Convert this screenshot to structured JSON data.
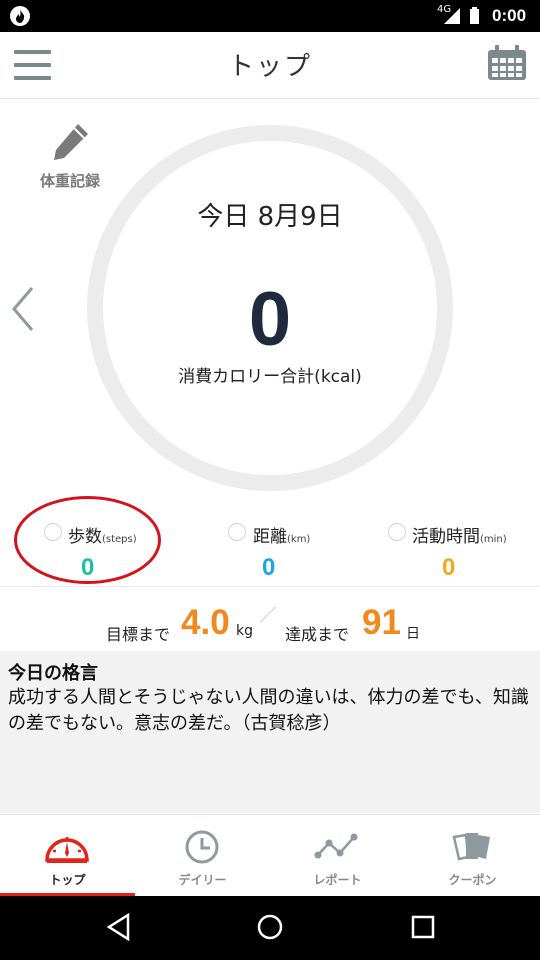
{
  "status_bar": {
    "network": "4G",
    "time": "0:00"
  },
  "header": {
    "title": "トップ"
  },
  "weight_record": {
    "label": "体重記録"
  },
  "summary": {
    "date": "今日 8月9日",
    "calories": "0",
    "calories_label": "消費カロリー合計(kcal)"
  },
  "stats": [
    {
      "label": "歩数",
      "unit": "(steps)",
      "value": "0",
      "color": "#1ec0a4"
    },
    {
      "label": "距離",
      "unit": "(km)",
      "value": "0",
      "color": "#1ea6e8"
    },
    {
      "label": "活動時間",
      "unit": "(min)",
      "value": "0",
      "color": "#f0a81c"
    }
  ],
  "goal": {
    "prefix": "目標まで",
    "weight": "4.0",
    "weight_unit": "kg",
    "days_prefix": "達成まで",
    "days": "91",
    "days_unit": "日"
  },
  "quote": {
    "title": "今日の格言",
    "body": "成功する人間とそうじゃない人間の違いは、体力の差でも、知識の差でもない。意志の差だ。（古賀稔彦）"
  },
  "bottom_nav": [
    {
      "label": "トップ",
      "icon": "speedometer-icon",
      "active": true
    },
    {
      "label": "デイリー",
      "icon": "clock-icon",
      "active": false
    },
    {
      "label": "レポート",
      "icon": "line-chart-icon",
      "active": false
    },
    {
      "label": "クーポン",
      "icon": "coupon-cards-icon",
      "active": false
    }
  ],
  "colors": {
    "accent": "#e2231a",
    "orange": "#f08a1c",
    "ring": "#ececec"
  }
}
